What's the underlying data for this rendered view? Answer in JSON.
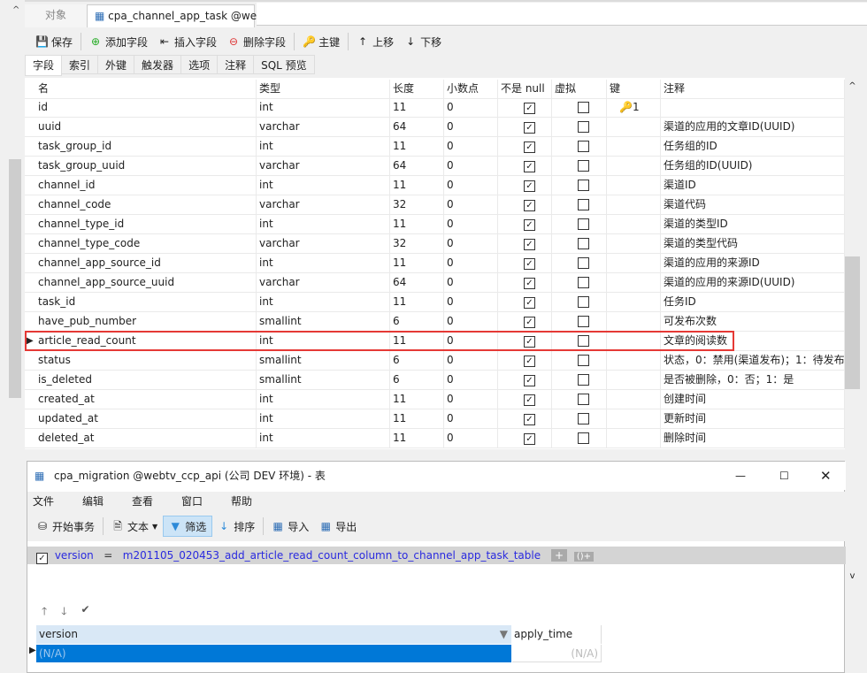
{
  "tabs": {
    "objects": "对象",
    "active": "cpa_channel_app_task @we..."
  },
  "toolbar": {
    "save": "保存",
    "add_field": "添加字段",
    "insert_field": "插入字段",
    "delete_field": "删除字段",
    "primary_key": "主键",
    "move_up": "上移",
    "move_down": "下移"
  },
  "subtabs": [
    "字段",
    "索引",
    "外键",
    "触发器",
    "选项",
    "注释",
    "SQL 预览"
  ],
  "columns": [
    "名",
    "类型",
    "长度",
    "小数点",
    "不是 null",
    "虚拟",
    "键",
    "注释"
  ],
  "rows": [
    {
      "name": "id",
      "type": "int",
      "len": "11",
      "dec": "0",
      "notnull": true,
      "virtual": false,
      "key": "1",
      "comment": ""
    },
    {
      "name": "uuid",
      "type": "varchar",
      "len": "64",
      "dec": "0",
      "notnull": true,
      "virtual": false,
      "key": "",
      "comment": "渠道的应用的文章ID(UUID)"
    },
    {
      "name": "task_group_id",
      "type": "int",
      "len": "11",
      "dec": "0",
      "notnull": true,
      "virtual": false,
      "key": "",
      "comment": "任务组的ID"
    },
    {
      "name": "task_group_uuid",
      "type": "varchar",
      "len": "64",
      "dec": "0",
      "notnull": true,
      "virtual": false,
      "key": "",
      "comment": "任务组的ID(UUID)"
    },
    {
      "name": "channel_id",
      "type": "int",
      "len": "11",
      "dec": "0",
      "notnull": true,
      "virtual": false,
      "key": "",
      "comment": "渠道ID"
    },
    {
      "name": "channel_code",
      "type": "varchar",
      "len": "32",
      "dec": "0",
      "notnull": true,
      "virtual": false,
      "key": "",
      "comment": "渠道代码"
    },
    {
      "name": "channel_type_id",
      "type": "int",
      "len": "11",
      "dec": "0",
      "notnull": true,
      "virtual": false,
      "key": "",
      "comment": "渠道的类型ID"
    },
    {
      "name": "channel_type_code",
      "type": "varchar",
      "len": "32",
      "dec": "0",
      "notnull": true,
      "virtual": false,
      "key": "",
      "comment": "渠道的类型代码"
    },
    {
      "name": "channel_app_source_id",
      "type": "int",
      "len": "11",
      "dec": "0",
      "notnull": true,
      "virtual": false,
      "key": "",
      "comment": "渠道的应用的来源ID"
    },
    {
      "name": "channel_app_source_uuid",
      "type": "varchar",
      "len": "64",
      "dec": "0",
      "notnull": true,
      "virtual": false,
      "key": "",
      "comment": "渠道的应用的来源ID(UUID)"
    },
    {
      "name": "task_id",
      "type": "int",
      "len": "11",
      "dec": "0",
      "notnull": true,
      "virtual": false,
      "key": "",
      "comment": "任务ID"
    },
    {
      "name": "have_pub_number",
      "type": "smallint",
      "len": "6",
      "dec": "0",
      "notnull": true,
      "virtual": false,
      "key": "",
      "comment": "可发布次数"
    },
    {
      "name": "article_read_count",
      "type": "int",
      "len": "11",
      "dec": "0",
      "notnull": true,
      "virtual": false,
      "key": "",
      "comment": "文章的阅读数"
    },
    {
      "name": "status",
      "type": "smallint",
      "len": "6",
      "dec": "0",
      "notnull": true,
      "virtual": false,
      "key": "",
      "comment": "状态，0：禁用(渠道发布)；1：待发布("
    },
    {
      "name": "is_deleted",
      "type": "smallint",
      "len": "6",
      "dec": "0",
      "notnull": true,
      "virtual": false,
      "key": "",
      "comment": "是否被删除，0：否；1：是"
    },
    {
      "name": "created_at",
      "type": "int",
      "len": "11",
      "dec": "0",
      "notnull": true,
      "virtual": false,
      "key": "",
      "comment": "创建时间"
    },
    {
      "name": "updated_at",
      "type": "int",
      "len": "11",
      "dec": "0",
      "notnull": true,
      "virtual": false,
      "key": "",
      "comment": "更新时间"
    },
    {
      "name": "deleted_at",
      "type": "int",
      "len": "11",
      "dec": "0",
      "notnull": true,
      "virtual": false,
      "key": "",
      "comment": "删除时间"
    }
  ],
  "window": {
    "title": "cpa_migration @webtv_ccp_api (公司 DEV 环境) - 表",
    "menu": [
      "文件",
      "编辑",
      "查看",
      "窗口",
      "帮助"
    ],
    "toolbar": {
      "begin_tx": "开始事务",
      "text": "文本",
      "filter": "筛选",
      "sort": "排序",
      "import": "导入",
      "export": "导出"
    },
    "filter": {
      "field": "version",
      "op": "=",
      "value": "m201105_020453_add_article_read_count_column_to_channel_app_task_table"
    },
    "grid": {
      "columns": [
        "version",
        "apply_time"
      ],
      "row": [
        "(N/A)",
        "(N/A)"
      ]
    }
  }
}
